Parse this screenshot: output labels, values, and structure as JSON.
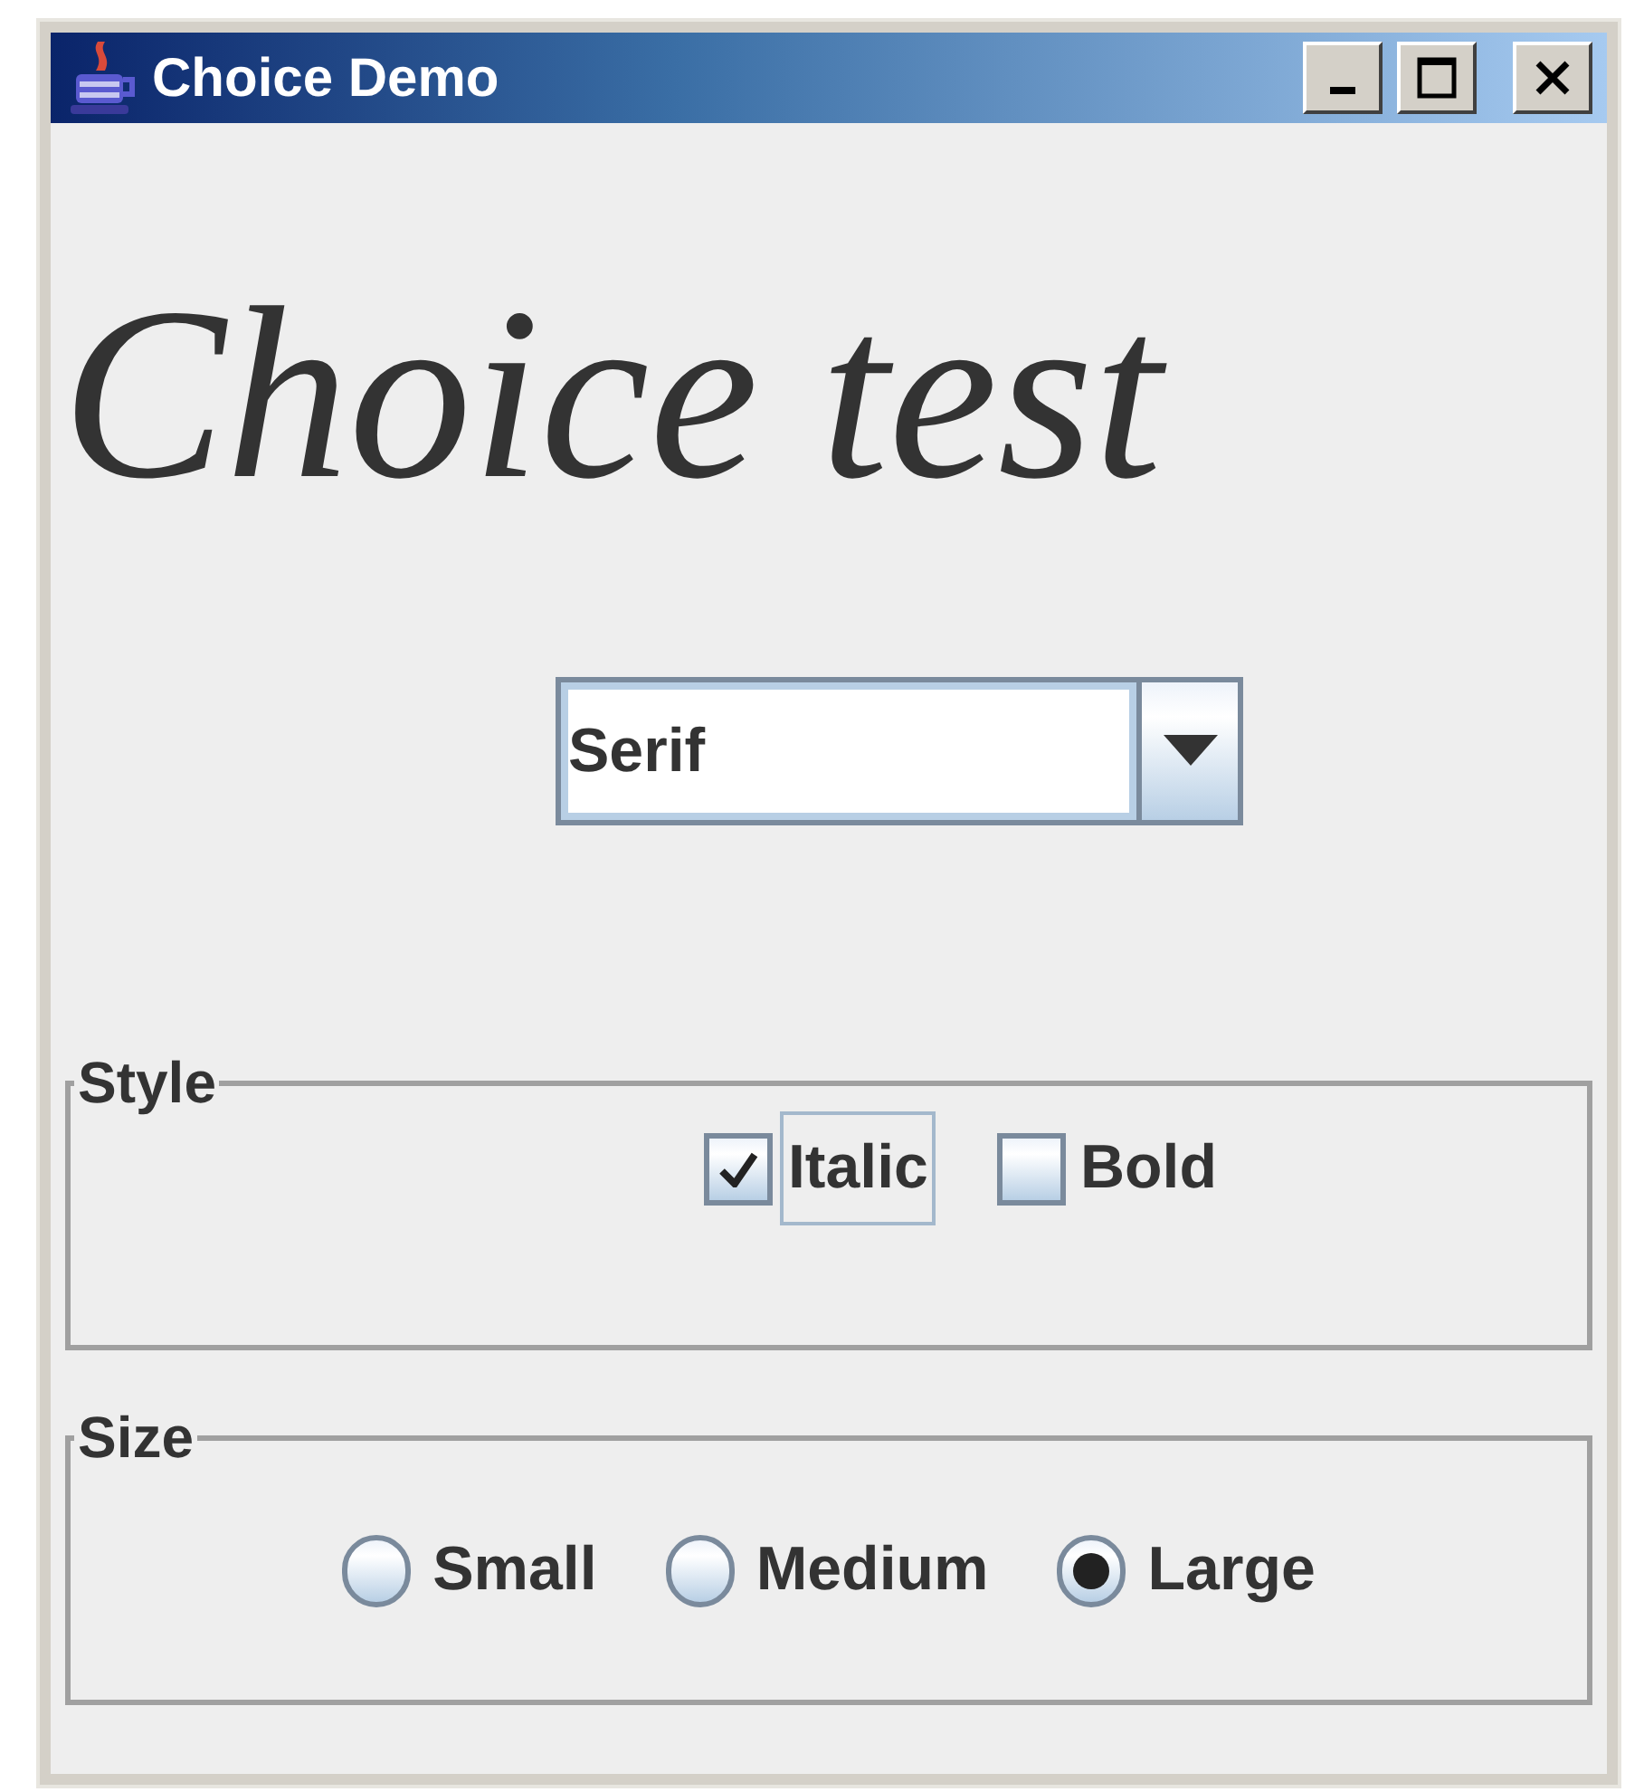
{
  "window": {
    "title": "Choice Demo"
  },
  "preview": {
    "text": "Choice test",
    "italic": true,
    "bold": false
  },
  "font_choice": {
    "value": "Serif"
  },
  "style_group": {
    "title": "Style",
    "checkboxes": [
      {
        "label": "Italic",
        "checked": true,
        "focused": true
      },
      {
        "label": "Bold",
        "checked": false,
        "focused": false
      }
    ]
  },
  "size_group": {
    "title": "Size",
    "options": [
      {
        "label": "Small",
        "selected": false
      },
      {
        "label": "Medium",
        "selected": false
      },
      {
        "label": "Large",
        "selected": true
      }
    ]
  }
}
